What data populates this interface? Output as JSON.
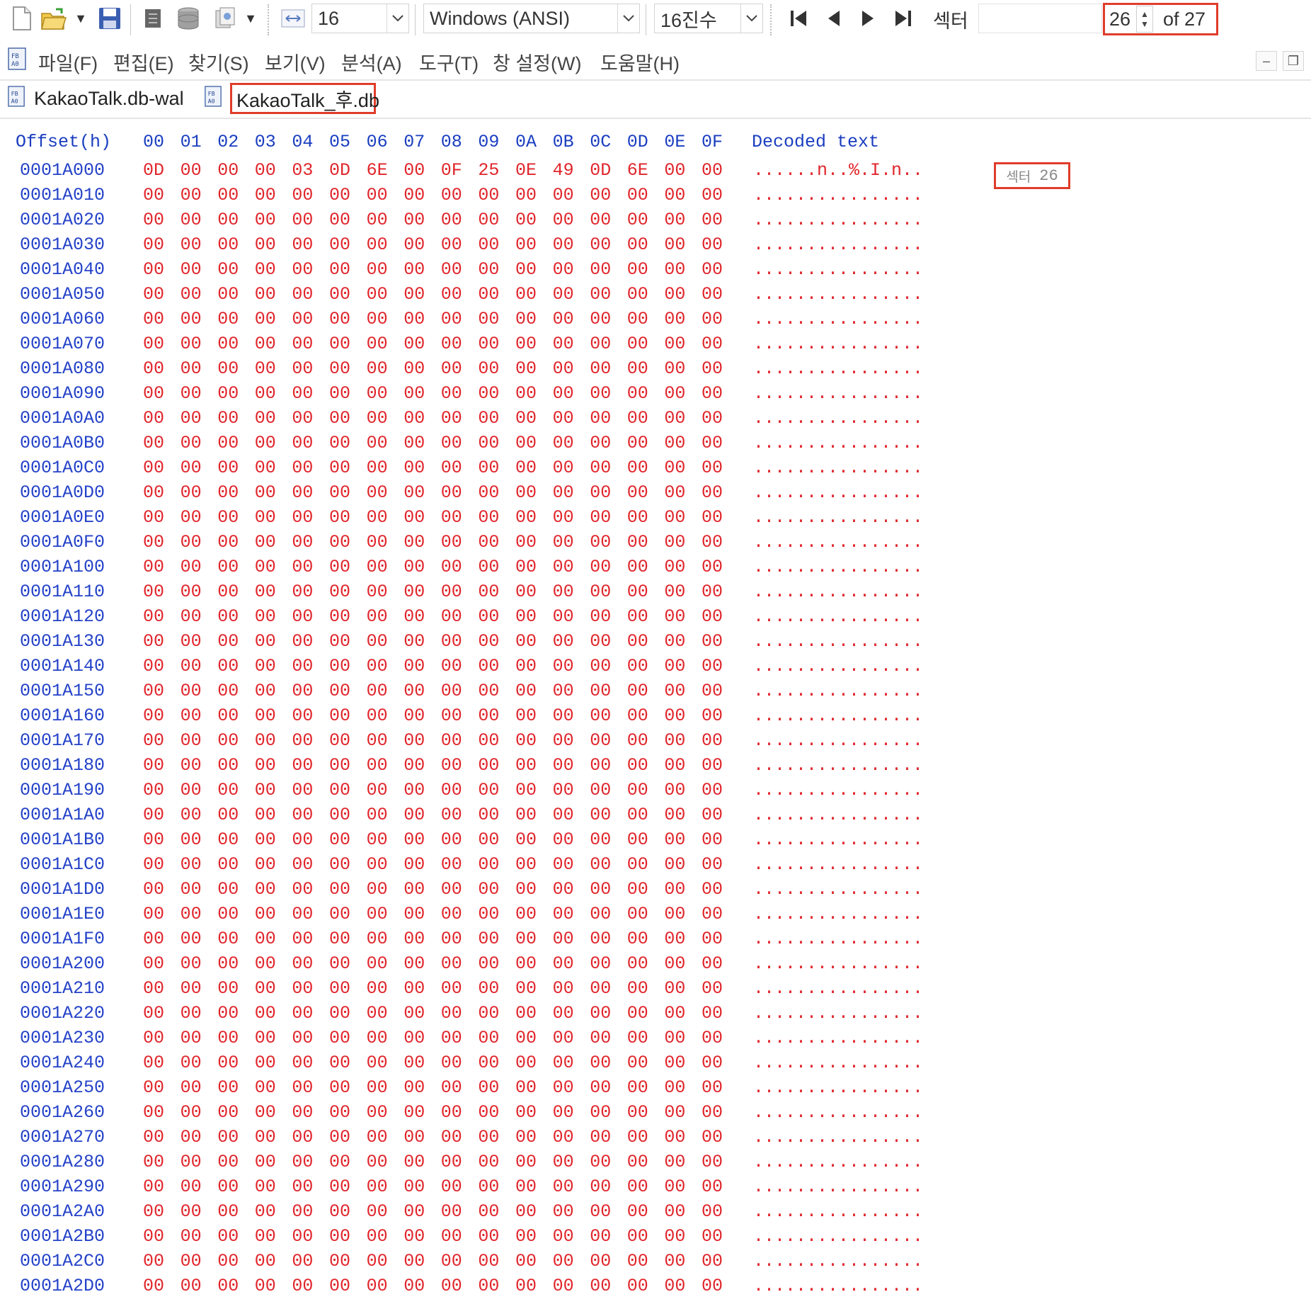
{
  "toolbar": {
    "icons": [
      "new-file-icon",
      "open-folder-icon",
      "save-icon",
      "notes-icon",
      "database-icon",
      "copy-icon"
    ],
    "bytes_per_row": "16",
    "encoding": "Windows (ANSI)",
    "radix": "16진수",
    "nav_label": "섹터",
    "sector_current": "26",
    "sector_total": "of 27"
  },
  "menu": {
    "items": [
      "파일(F)",
      "편집(E)",
      "찾기(S)",
      "보기(V)",
      "분석(A)",
      "도구(T)",
      "창 설정(W)",
      "도움말(H)"
    ],
    "minimize": "–",
    "restore": "❐"
  },
  "tabs": {
    "inactive": "KakaoTalk.db-wal",
    "active": "KakaoTalk_후.db"
  },
  "hex": {
    "header_offset": "Offset(h)",
    "header_columns": [
      "00",
      "01",
      "02",
      "03",
      "04",
      "05",
      "06",
      "07",
      "08",
      "09",
      "0A",
      "0B",
      "0C",
      "0D",
      "0E",
      "0F"
    ],
    "header_text": "Decoded text",
    "sector_tag_label": "섹터",
    "sector_tag_value": "26",
    "rows": [
      {
        "offset": "0001A000",
        "bytes": [
          "0D",
          "00",
          "00",
          "00",
          "03",
          "0D",
          "6E",
          "00",
          "0F",
          "25",
          "0E",
          "49",
          "0D",
          "6E",
          "00",
          "00"
        ],
        "text": "......n..%.I.n.."
      },
      {
        "offset": "0001A010",
        "bytes": [
          "00",
          "00",
          "00",
          "00",
          "00",
          "00",
          "00",
          "00",
          "00",
          "00",
          "00",
          "00",
          "00",
          "00",
          "00",
          "00"
        ],
        "text": "................"
      },
      {
        "offset": "0001A020",
        "bytes": [
          "00",
          "00",
          "00",
          "00",
          "00",
          "00",
          "00",
          "00",
          "00",
          "00",
          "00",
          "00",
          "00",
          "00",
          "00",
          "00"
        ],
        "text": "................"
      },
      {
        "offset": "0001A030",
        "bytes": [
          "00",
          "00",
          "00",
          "00",
          "00",
          "00",
          "00",
          "00",
          "00",
          "00",
          "00",
          "00",
          "00",
          "00",
          "00",
          "00"
        ],
        "text": "................"
      },
      {
        "offset": "0001A040",
        "bytes": [
          "00",
          "00",
          "00",
          "00",
          "00",
          "00",
          "00",
          "00",
          "00",
          "00",
          "00",
          "00",
          "00",
          "00",
          "00",
          "00"
        ],
        "text": "................"
      },
      {
        "offset": "0001A050",
        "bytes": [
          "00",
          "00",
          "00",
          "00",
          "00",
          "00",
          "00",
          "00",
          "00",
          "00",
          "00",
          "00",
          "00",
          "00",
          "00",
          "00"
        ],
        "text": "................"
      },
      {
        "offset": "0001A060",
        "bytes": [
          "00",
          "00",
          "00",
          "00",
          "00",
          "00",
          "00",
          "00",
          "00",
          "00",
          "00",
          "00",
          "00",
          "00",
          "00",
          "00"
        ],
        "text": "................"
      },
      {
        "offset": "0001A070",
        "bytes": [
          "00",
          "00",
          "00",
          "00",
          "00",
          "00",
          "00",
          "00",
          "00",
          "00",
          "00",
          "00",
          "00",
          "00",
          "00",
          "00"
        ],
        "text": "................"
      },
      {
        "offset": "0001A080",
        "bytes": [
          "00",
          "00",
          "00",
          "00",
          "00",
          "00",
          "00",
          "00",
          "00",
          "00",
          "00",
          "00",
          "00",
          "00",
          "00",
          "00"
        ],
        "text": "................"
      },
      {
        "offset": "0001A090",
        "bytes": [
          "00",
          "00",
          "00",
          "00",
          "00",
          "00",
          "00",
          "00",
          "00",
          "00",
          "00",
          "00",
          "00",
          "00",
          "00",
          "00"
        ],
        "text": "................"
      },
      {
        "offset": "0001A0A0",
        "bytes": [
          "00",
          "00",
          "00",
          "00",
          "00",
          "00",
          "00",
          "00",
          "00",
          "00",
          "00",
          "00",
          "00",
          "00",
          "00",
          "00"
        ],
        "text": "................"
      },
      {
        "offset": "0001A0B0",
        "bytes": [
          "00",
          "00",
          "00",
          "00",
          "00",
          "00",
          "00",
          "00",
          "00",
          "00",
          "00",
          "00",
          "00",
          "00",
          "00",
          "00"
        ],
        "text": "................"
      },
      {
        "offset": "0001A0C0",
        "bytes": [
          "00",
          "00",
          "00",
          "00",
          "00",
          "00",
          "00",
          "00",
          "00",
          "00",
          "00",
          "00",
          "00",
          "00",
          "00",
          "00"
        ],
        "text": "................"
      },
      {
        "offset": "0001A0D0",
        "bytes": [
          "00",
          "00",
          "00",
          "00",
          "00",
          "00",
          "00",
          "00",
          "00",
          "00",
          "00",
          "00",
          "00",
          "00",
          "00",
          "00"
        ],
        "text": "................"
      },
      {
        "offset": "0001A0E0",
        "bytes": [
          "00",
          "00",
          "00",
          "00",
          "00",
          "00",
          "00",
          "00",
          "00",
          "00",
          "00",
          "00",
          "00",
          "00",
          "00",
          "00"
        ],
        "text": "................"
      },
      {
        "offset": "0001A0F0",
        "bytes": [
          "00",
          "00",
          "00",
          "00",
          "00",
          "00",
          "00",
          "00",
          "00",
          "00",
          "00",
          "00",
          "00",
          "00",
          "00",
          "00"
        ],
        "text": "................"
      },
      {
        "offset": "0001A100",
        "bytes": [
          "00",
          "00",
          "00",
          "00",
          "00",
          "00",
          "00",
          "00",
          "00",
          "00",
          "00",
          "00",
          "00",
          "00",
          "00",
          "00"
        ],
        "text": "................"
      },
      {
        "offset": "0001A110",
        "bytes": [
          "00",
          "00",
          "00",
          "00",
          "00",
          "00",
          "00",
          "00",
          "00",
          "00",
          "00",
          "00",
          "00",
          "00",
          "00",
          "00"
        ],
        "text": "................"
      },
      {
        "offset": "0001A120",
        "bytes": [
          "00",
          "00",
          "00",
          "00",
          "00",
          "00",
          "00",
          "00",
          "00",
          "00",
          "00",
          "00",
          "00",
          "00",
          "00",
          "00"
        ],
        "text": "................"
      },
      {
        "offset": "0001A130",
        "bytes": [
          "00",
          "00",
          "00",
          "00",
          "00",
          "00",
          "00",
          "00",
          "00",
          "00",
          "00",
          "00",
          "00",
          "00",
          "00",
          "00"
        ],
        "text": "................"
      },
      {
        "offset": "0001A140",
        "bytes": [
          "00",
          "00",
          "00",
          "00",
          "00",
          "00",
          "00",
          "00",
          "00",
          "00",
          "00",
          "00",
          "00",
          "00",
          "00",
          "00"
        ],
        "text": "................"
      },
      {
        "offset": "0001A150",
        "bytes": [
          "00",
          "00",
          "00",
          "00",
          "00",
          "00",
          "00",
          "00",
          "00",
          "00",
          "00",
          "00",
          "00",
          "00",
          "00",
          "00"
        ],
        "text": "................"
      },
      {
        "offset": "0001A160",
        "bytes": [
          "00",
          "00",
          "00",
          "00",
          "00",
          "00",
          "00",
          "00",
          "00",
          "00",
          "00",
          "00",
          "00",
          "00",
          "00",
          "00"
        ],
        "text": "................"
      },
      {
        "offset": "0001A170",
        "bytes": [
          "00",
          "00",
          "00",
          "00",
          "00",
          "00",
          "00",
          "00",
          "00",
          "00",
          "00",
          "00",
          "00",
          "00",
          "00",
          "00"
        ],
        "text": "................"
      },
      {
        "offset": "0001A180",
        "bytes": [
          "00",
          "00",
          "00",
          "00",
          "00",
          "00",
          "00",
          "00",
          "00",
          "00",
          "00",
          "00",
          "00",
          "00",
          "00",
          "00"
        ],
        "text": "................"
      },
      {
        "offset": "0001A190",
        "bytes": [
          "00",
          "00",
          "00",
          "00",
          "00",
          "00",
          "00",
          "00",
          "00",
          "00",
          "00",
          "00",
          "00",
          "00",
          "00",
          "00"
        ],
        "text": "................"
      },
      {
        "offset": "0001A1A0",
        "bytes": [
          "00",
          "00",
          "00",
          "00",
          "00",
          "00",
          "00",
          "00",
          "00",
          "00",
          "00",
          "00",
          "00",
          "00",
          "00",
          "00"
        ],
        "text": "................"
      },
      {
        "offset": "0001A1B0",
        "bytes": [
          "00",
          "00",
          "00",
          "00",
          "00",
          "00",
          "00",
          "00",
          "00",
          "00",
          "00",
          "00",
          "00",
          "00",
          "00",
          "00"
        ],
        "text": "................"
      },
      {
        "offset": "0001A1C0",
        "bytes": [
          "00",
          "00",
          "00",
          "00",
          "00",
          "00",
          "00",
          "00",
          "00",
          "00",
          "00",
          "00",
          "00",
          "00",
          "00",
          "00"
        ],
        "text": "................"
      },
      {
        "offset": "0001A1D0",
        "bytes": [
          "00",
          "00",
          "00",
          "00",
          "00",
          "00",
          "00",
          "00",
          "00",
          "00",
          "00",
          "00",
          "00",
          "00",
          "00",
          "00"
        ],
        "text": "................"
      },
      {
        "offset": "0001A1E0",
        "bytes": [
          "00",
          "00",
          "00",
          "00",
          "00",
          "00",
          "00",
          "00",
          "00",
          "00",
          "00",
          "00",
          "00",
          "00",
          "00",
          "00"
        ],
        "text": "................"
      },
      {
        "offset": "0001A1F0",
        "bytes": [
          "00",
          "00",
          "00",
          "00",
          "00",
          "00",
          "00",
          "00",
          "00",
          "00",
          "00",
          "00",
          "00",
          "00",
          "00",
          "00"
        ],
        "text": "................"
      },
      {
        "offset": "0001A200",
        "bytes": [
          "00",
          "00",
          "00",
          "00",
          "00",
          "00",
          "00",
          "00",
          "00",
          "00",
          "00",
          "00",
          "00",
          "00",
          "00",
          "00"
        ],
        "text": "................"
      },
      {
        "offset": "0001A210",
        "bytes": [
          "00",
          "00",
          "00",
          "00",
          "00",
          "00",
          "00",
          "00",
          "00",
          "00",
          "00",
          "00",
          "00",
          "00",
          "00",
          "00"
        ],
        "text": "................"
      },
      {
        "offset": "0001A220",
        "bytes": [
          "00",
          "00",
          "00",
          "00",
          "00",
          "00",
          "00",
          "00",
          "00",
          "00",
          "00",
          "00",
          "00",
          "00",
          "00",
          "00"
        ],
        "text": "................"
      },
      {
        "offset": "0001A230",
        "bytes": [
          "00",
          "00",
          "00",
          "00",
          "00",
          "00",
          "00",
          "00",
          "00",
          "00",
          "00",
          "00",
          "00",
          "00",
          "00",
          "00"
        ],
        "text": "................"
      },
      {
        "offset": "0001A240",
        "bytes": [
          "00",
          "00",
          "00",
          "00",
          "00",
          "00",
          "00",
          "00",
          "00",
          "00",
          "00",
          "00",
          "00",
          "00",
          "00",
          "00"
        ],
        "text": "................"
      },
      {
        "offset": "0001A250",
        "bytes": [
          "00",
          "00",
          "00",
          "00",
          "00",
          "00",
          "00",
          "00",
          "00",
          "00",
          "00",
          "00",
          "00",
          "00",
          "00",
          "00"
        ],
        "text": "................"
      },
      {
        "offset": "0001A260",
        "bytes": [
          "00",
          "00",
          "00",
          "00",
          "00",
          "00",
          "00",
          "00",
          "00",
          "00",
          "00",
          "00",
          "00",
          "00",
          "00",
          "00"
        ],
        "text": "................"
      },
      {
        "offset": "0001A270",
        "bytes": [
          "00",
          "00",
          "00",
          "00",
          "00",
          "00",
          "00",
          "00",
          "00",
          "00",
          "00",
          "00",
          "00",
          "00",
          "00",
          "00"
        ],
        "text": "................"
      },
      {
        "offset": "0001A280",
        "bytes": [
          "00",
          "00",
          "00",
          "00",
          "00",
          "00",
          "00",
          "00",
          "00",
          "00",
          "00",
          "00",
          "00",
          "00",
          "00",
          "00"
        ],
        "text": "................"
      },
      {
        "offset": "0001A290",
        "bytes": [
          "00",
          "00",
          "00",
          "00",
          "00",
          "00",
          "00",
          "00",
          "00",
          "00",
          "00",
          "00",
          "00",
          "00",
          "00",
          "00"
        ],
        "text": "................"
      },
      {
        "offset": "0001A2A0",
        "bytes": [
          "00",
          "00",
          "00",
          "00",
          "00",
          "00",
          "00",
          "00",
          "00",
          "00",
          "00",
          "00",
          "00",
          "00",
          "00",
          "00"
        ],
        "text": "................"
      },
      {
        "offset": "0001A2B0",
        "bytes": [
          "00",
          "00",
          "00",
          "00",
          "00",
          "00",
          "00",
          "00",
          "00",
          "00",
          "00",
          "00",
          "00",
          "00",
          "00",
          "00"
        ],
        "text": "................"
      },
      {
        "offset": "0001A2C0",
        "bytes": [
          "00",
          "00",
          "00",
          "00",
          "00",
          "00",
          "00",
          "00",
          "00",
          "00",
          "00",
          "00",
          "00",
          "00",
          "00",
          "00"
        ],
        "text": "................"
      },
      {
        "offset": "0001A2D0",
        "bytes": [
          "00",
          "00",
          "00",
          "00",
          "00",
          "00",
          "00",
          "00",
          "00",
          "00",
          "00",
          "00",
          "00",
          "00",
          "00",
          "00"
        ],
        "text": "................"
      }
    ]
  },
  "colors": {
    "offset_blue": "#2442c8",
    "byte_red": "#e0262c",
    "highlight_box": "#e03c2a"
  }
}
